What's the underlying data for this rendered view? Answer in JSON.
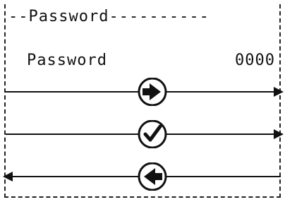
{
  "header": {
    "title": "--Password----------"
  },
  "field": {
    "label": "Password",
    "value": "0000"
  },
  "actions": [
    {
      "icon": "arrow-right-circle-icon",
      "direction": "right"
    },
    {
      "icon": "checkmark-circle-icon",
      "direction": "right"
    },
    {
      "icon": "arrow-left-circle-icon",
      "direction": "left"
    }
  ]
}
